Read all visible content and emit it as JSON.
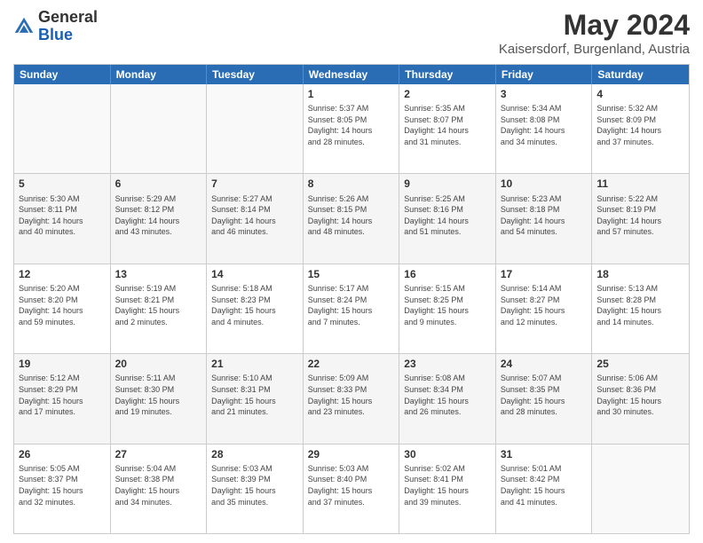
{
  "header": {
    "logo_general": "General",
    "logo_blue": "Blue",
    "month_title": "May 2024",
    "location": "Kaisersdorf, Burgenland, Austria"
  },
  "days_of_week": [
    "Sunday",
    "Monday",
    "Tuesday",
    "Wednesday",
    "Thursday",
    "Friday",
    "Saturday"
  ],
  "weeks": [
    [
      {
        "day": "",
        "info": ""
      },
      {
        "day": "",
        "info": ""
      },
      {
        "day": "",
        "info": ""
      },
      {
        "day": "1",
        "info": "Sunrise: 5:37 AM\nSunset: 8:05 PM\nDaylight: 14 hours\nand 28 minutes."
      },
      {
        "day": "2",
        "info": "Sunrise: 5:35 AM\nSunset: 8:07 PM\nDaylight: 14 hours\nand 31 minutes."
      },
      {
        "day": "3",
        "info": "Sunrise: 5:34 AM\nSunset: 8:08 PM\nDaylight: 14 hours\nand 34 minutes."
      },
      {
        "day": "4",
        "info": "Sunrise: 5:32 AM\nSunset: 8:09 PM\nDaylight: 14 hours\nand 37 minutes."
      }
    ],
    [
      {
        "day": "5",
        "info": "Sunrise: 5:30 AM\nSunset: 8:11 PM\nDaylight: 14 hours\nand 40 minutes."
      },
      {
        "day": "6",
        "info": "Sunrise: 5:29 AM\nSunset: 8:12 PM\nDaylight: 14 hours\nand 43 minutes."
      },
      {
        "day": "7",
        "info": "Sunrise: 5:27 AM\nSunset: 8:14 PM\nDaylight: 14 hours\nand 46 minutes."
      },
      {
        "day": "8",
        "info": "Sunrise: 5:26 AM\nSunset: 8:15 PM\nDaylight: 14 hours\nand 48 minutes."
      },
      {
        "day": "9",
        "info": "Sunrise: 5:25 AM\nSunset: 8:16 PM\nDaylight: 14 hours\nand 51 minutes."
      },
      {
        "day": "10",
        "info": "Sunrise: 5:23 AM\nSunset: 8:18 PM\nDaylight: 14 hours\nand 54 minutes."
      },
      {
        "day": "11",
        "info": "Sunrise: 5:22 AM\nSunset: 8:19 PM\nDaylight: 14 hours\nand 57 minutes."
      }
    ],
    [
      {
        "day": "12",
        "info": "Sunrise: 5:20 AM\nSunset: 8:20 PM\nDaylight: 14 hours\nand 59 minutes."
      },
      {
        "day": "13",
        "info": "Sunrise: 5:19 AM\nSunset: 8:21 PM\nDaylight: 15 hours\nand 2 minutes."
      },
      {
        "day": "14",
        "info": "Sunrise: 5:18 AM\nSunset: 8:23 PM\nDaylight: 15 hours\nand 4 minutes."
      },
      {
        "day": "15",
        "info": "Sunrise: 5:17 AM\nSunset: 8:24 PM\nDaylight: 15 hours\nand 7 minutes."
      },
      {
        "day": "16",
        "info": "Sunrise: 5:15 AM\nSunset: 8:25 PM\nDaylight: 15 hours\nand 9 minutes."
      },
      {
        "day": "17",
        "info": "Sunrise: 5:14 AM\nSunset: 8:27 PM\nDaylight: 15 hours\nand 12 minutes."
      },
      {
        "day": "18",
        "info": "Sunrise: 5:13 AM\nSunset: 8:28 PM\nDaylight: 15 hours\nand 14 minutes."
      }
    ],
    [
      {
        "day": "19",
        "info": "Sunrise: 5:12 AM\nSunset: 8:29 PM\nDaylight: 15 hours\nand 17 minutes."
      },
      {
        "day": "20",
        "info": "Sunrise: 5:11 AM\nSunset: 8:30 PM\nDaylight: 15 hours\nand 19 minutes."
      },
      {
        "day": "21",
        "info": "Sunrise: 5:10 AM\nSunset: 8:31 PM\nDaylight: 15 hours\nand 21 minutes."
      },
      {
        "day": "22",
        "info": "Sunrise: 5:09 AM\nSunset: 8:33 PM\nDaylight: 15 hours\nand 23 minutes."
      },
      {
        "day": "23",
        "info": "Sunrise: 5:08 AM\nSunset: 8:34 PM\nDaylight: 15 hours\nand 26 minutes."
      },
      {
        "day": "24",
        "info": "Sunrise: 5:07 AM\nSunset: 8:35 PM\nDaylight: 15 hours\nand 28 minutes."
      },
      {
        "day": "25",
        "info": "Sunrise: 5:06 AM\nSunset: 8:36 PM\nDaylight: 15 hours\nand 30 minutes."
      }
    ],
    [
      {
        "day": "26",
        "info": "Sunrise: 5:05 AM\nSunset: 8:37 PM\nDaylight: 15 hours\nand 32 minutes."
      },
      {
        "day": "27",
        "info": "Sunrise: 5:04 AM\nSunset: 8:38 PM\nDaylight: 15 hours\nand 34 minutes."
      },
      {
        "day": "28",
        "info": "Sunrise: 5:03 AM\nSunset: 8:39 PM\nDaylight: 15 hours\nand 35 minutes."
      },
      {
        "day": "29",
        "info": "Sunrise: 5:03 AM\nSunset: 8:40 PM\nDaylight: 15 hours\nand 37 minutes."
      },
      {
        "day": "30",
        "info": "Sunrise: 5:02 AM\nSunset: 8:41 PM\nDaylight: 15 hours\nand 39 minutes."
      },
      {
        "day": "31",
        "info": "Sunrise: 5:01 AM\nSunset: 8:42 PM\nDaylight: 15 hours\nand 41 minutes."
      },
      {
        "day": "",
        "info": ""
      }
    ]
  ]
}
